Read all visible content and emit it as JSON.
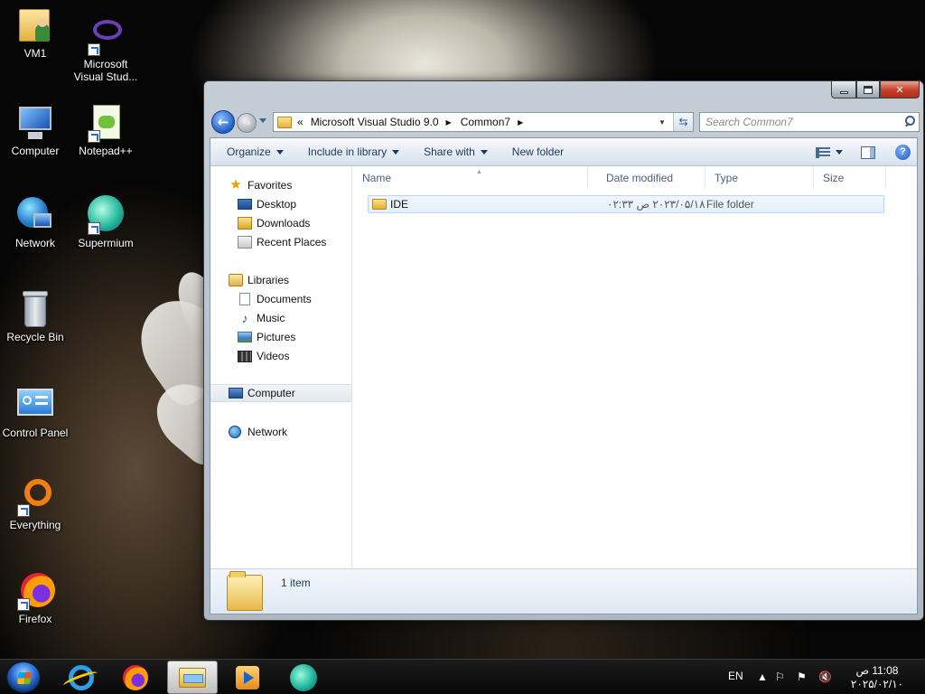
{
  "desktop": {
    "icons": [
      {
        "label": "VM1",
        "icon": "user-folder-icon"
      },
      {
        "label": "Microsoft Visual Stud...",
        "icon": "visual-studio-icon"
      },
      {
        "label": "Computer",
        "icon": "computer-icon"
      },
      {
        "label": "Notepad++",
        "icon": "notepad-plus-plus-icon"
      },
      {
        "label": "Network",
        "icon": "network-icon"
      },
      {
        "label": "Supermium",
        "icon": "supermium-icon"
      },
      {
        "label": "Recycle Bin",
        "icon": "recycle-bin-icon"
      },
      {
        "label": "Control Panel",
        "icon": "control-panel-icon"
      },
      {
        "label": "Everything",
        "icon": "everything-search-icon"
      },
      {
        "label": "Firefox",
        "icon": "firefox-icon"
      }
    ]
  },
  "explorer": {
    "breadcrumb": {
      "overflow": "«",
      "segments": [
        "Microsoft Visual Studio 9.0",
        "Common7"
      ]
    },
    "search_placeholder": "Search Common7",
    "toolbar": {
      "organize": "Organize",
      "include_in_library": "Include in library",
      "share_with": "Share with",
      "new_folder": "New folder"
    },
    "nav": {
      "favorites": "Favorites",
      "desktop": "Desktop",
      "downloads": "Downloads",
      "recent_places": "Recent Places",
      "libraries": "Libraries",
      "documents": "Documents",
      "music": "Music",
      "pictures": "Pictures",
      "videos": "Videos",
      "computer": "Computer",
      "network": "Network"
    },
    "columns": {
      "name": "Name",
      "date_modified": "Date modified",
      "type": "Type",
      "size": "Size"
    },
    "files": [
      {
        "name": "IDE",
        "date_modified": "۲۰۲۳/۰۵/۱۸ ص ۰۲:۳۳",
        "type": "File folder",
        "size": ""
      }
    ],
    "status": {
      "item_count": "1 item"
    },
    "help_glyph": "?"
  },
  "taskbar": {
    "apps": [
      "internet-explorer-icon",
      "firefox-icon",
      "windows-explorer-icon",
      "media-player-icon",
      "supermium-icon"
    ],
    "tray": {
      "language": "EN",
      "time": "11:08 ص",
      "date": "۲۰۲۵/۰۲/۱۰"
    }
  }
}
